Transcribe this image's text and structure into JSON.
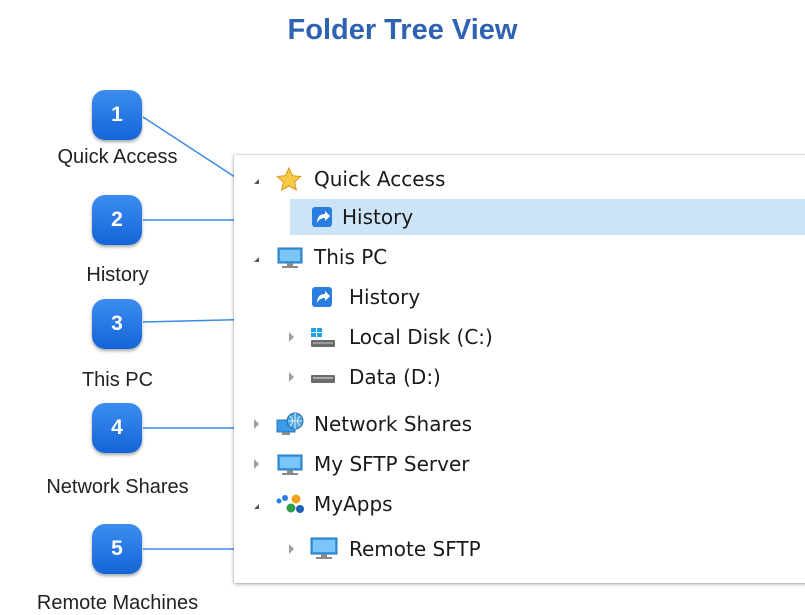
{
  "title": "Folder Tree View",
  "callouts": [
    {
      "number": "1",
      "label": "Quick Access"
    },
    {
      "number": "2",
      "label": "History"
    },
    {
      "number": "3",
      "label": "This PC"
    },
    {
      "number": "4",
      "label": "Network Shares"
    },
    {
      "number": "5",
      "label": "Remote Machines"
    }
  ],
  "tree": [
    {
      "label": "Quick Access",
      "icon": "star-icon",
      "expander": "expanded"
    },
    {
      "label": "History",
      "icon": "shortcut-icon",
      "selected": true
    },
    {
      "label": "This PC",
      "icon": "computer-icon",
      "expander": "expanded"
    },
    {
      "label": "History",
      "icon": "shortcut-icon"
    },
    {
      "label": "Local Disk (C:)",
      "icon": "windows-drive-icon",
      "expander": "collapsed"
    },
    {
      "label": "Data (D:)",
      "icon": "drive-icon",
      "expander": "collapsed"
    },
    {
      "label": "Network Shares",
      "icon": "network-globe-icon",
      "expander": "collapsed"
    },
    {
      "label": "My SFTP Server",
      "icon": "computer-icon",
      "expander": "collapsed"
    },
    {
      "label": "MyApps",
      "icon": "apps-group-icon",
      "expander": "expanded"
    },
    {
      "label": "Remote SFTP",
      "icon": "computer-icon",
      "expander": "collapsed"
    }
  ],
  "colors": {
    "title": "#2f62b0",
    "callout": "#1d6fe0",
    "selection": "#cce4f7",
    "connector": "#3d8ae6"
  }
}
